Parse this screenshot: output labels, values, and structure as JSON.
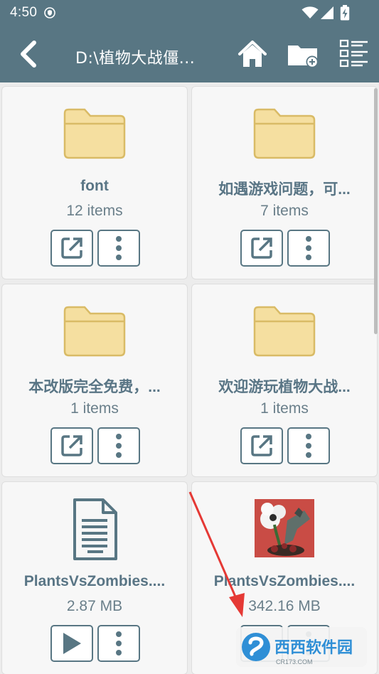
{
  "status_bar": {
    "time": "4:50",
    "icons": [
      "shield-icon",
      "wifi-icon",
      "signal-icon",
      "battery-charging-icon"
    ]
  },
  "toolbar": {
    "title": "D:\\植物大战僵...",
    "icons": [
      "back-arrow-icon",
      "home-icon",
      "new-folder-icon",
      "list-view-icon"
    ]
  },
  "items": [
    {
      "name": "font",
      "meta": "12 items",
      "kind": "folder"
    },
    {
      "name": "如遇游戏问题，可...",
      "meta": "7 items",
      "kind": "folder"
    },
    {
      "name": "本改版完全免费，...",
      "meta": "1 items",
      "kind": "folder"
    },
    {
      "name": "欢迎游玩植物大战...",
      "meta": "1 items",
      "kind": "folder"
    },
    {
      "name": "PlantsVsZombies....",
      "meta": "2.87 MB",
      "kind": "document"
    },
    {
      "name": "PlantsVsZombies....",
      "meta": "342.16 MB",
      "kind": "game-app"
    }
  ],
  "watermark": {
    "text": "西西软件园",
    "sub": "CR173.COM"
  },
  "colors": {
    "toolbar": "#587683",
    "folder_fill": "#f5dfa0",
    "folder_stroke": "#d9bb66",
    "text": "#597585",
    "annotation_arrow": "#e53935"
  }
}
